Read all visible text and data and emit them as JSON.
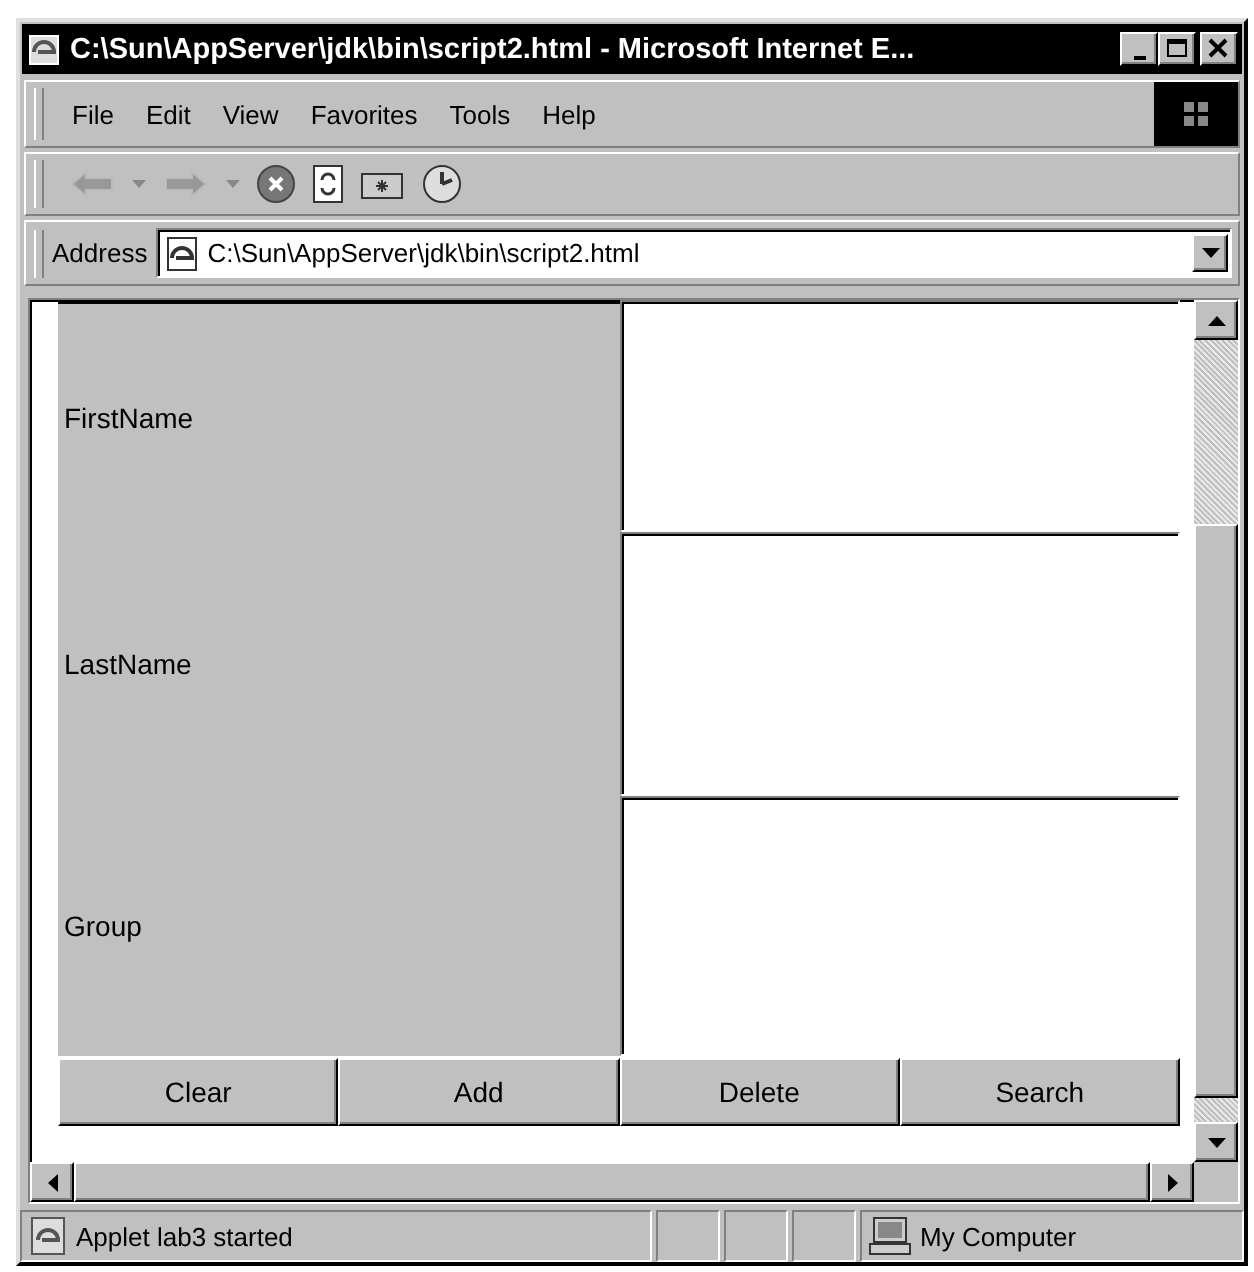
{
  "window": {
    "title": "C:\\Sun\\AppServer\\jdk\\bin\\script2.html - Microsoft Internet E..."
  },
  "menu": [
    "File",
    "Edit",
    "View",
    "Favorites",
    "Tools",
    "Help"
  ],
  "address": {
    "label": "Address",
    "value": "C:\\Sun\\AppServer\\jdk\\bin\\script2.html"
  },
  "form": {
    "fields": [
      {
        "label": "FirstName"
      },
      {
        "label": "LastName"
      },
      {
        "label": "Group"
      }
    ],
    "buttons": [
      "Clear",
      "Add",
      "Delete",
      "Search"
    ]
  },
  "status_bar": {
    "message": "Applet lab3 started",
    "zone": "My Computer"
  }
}
